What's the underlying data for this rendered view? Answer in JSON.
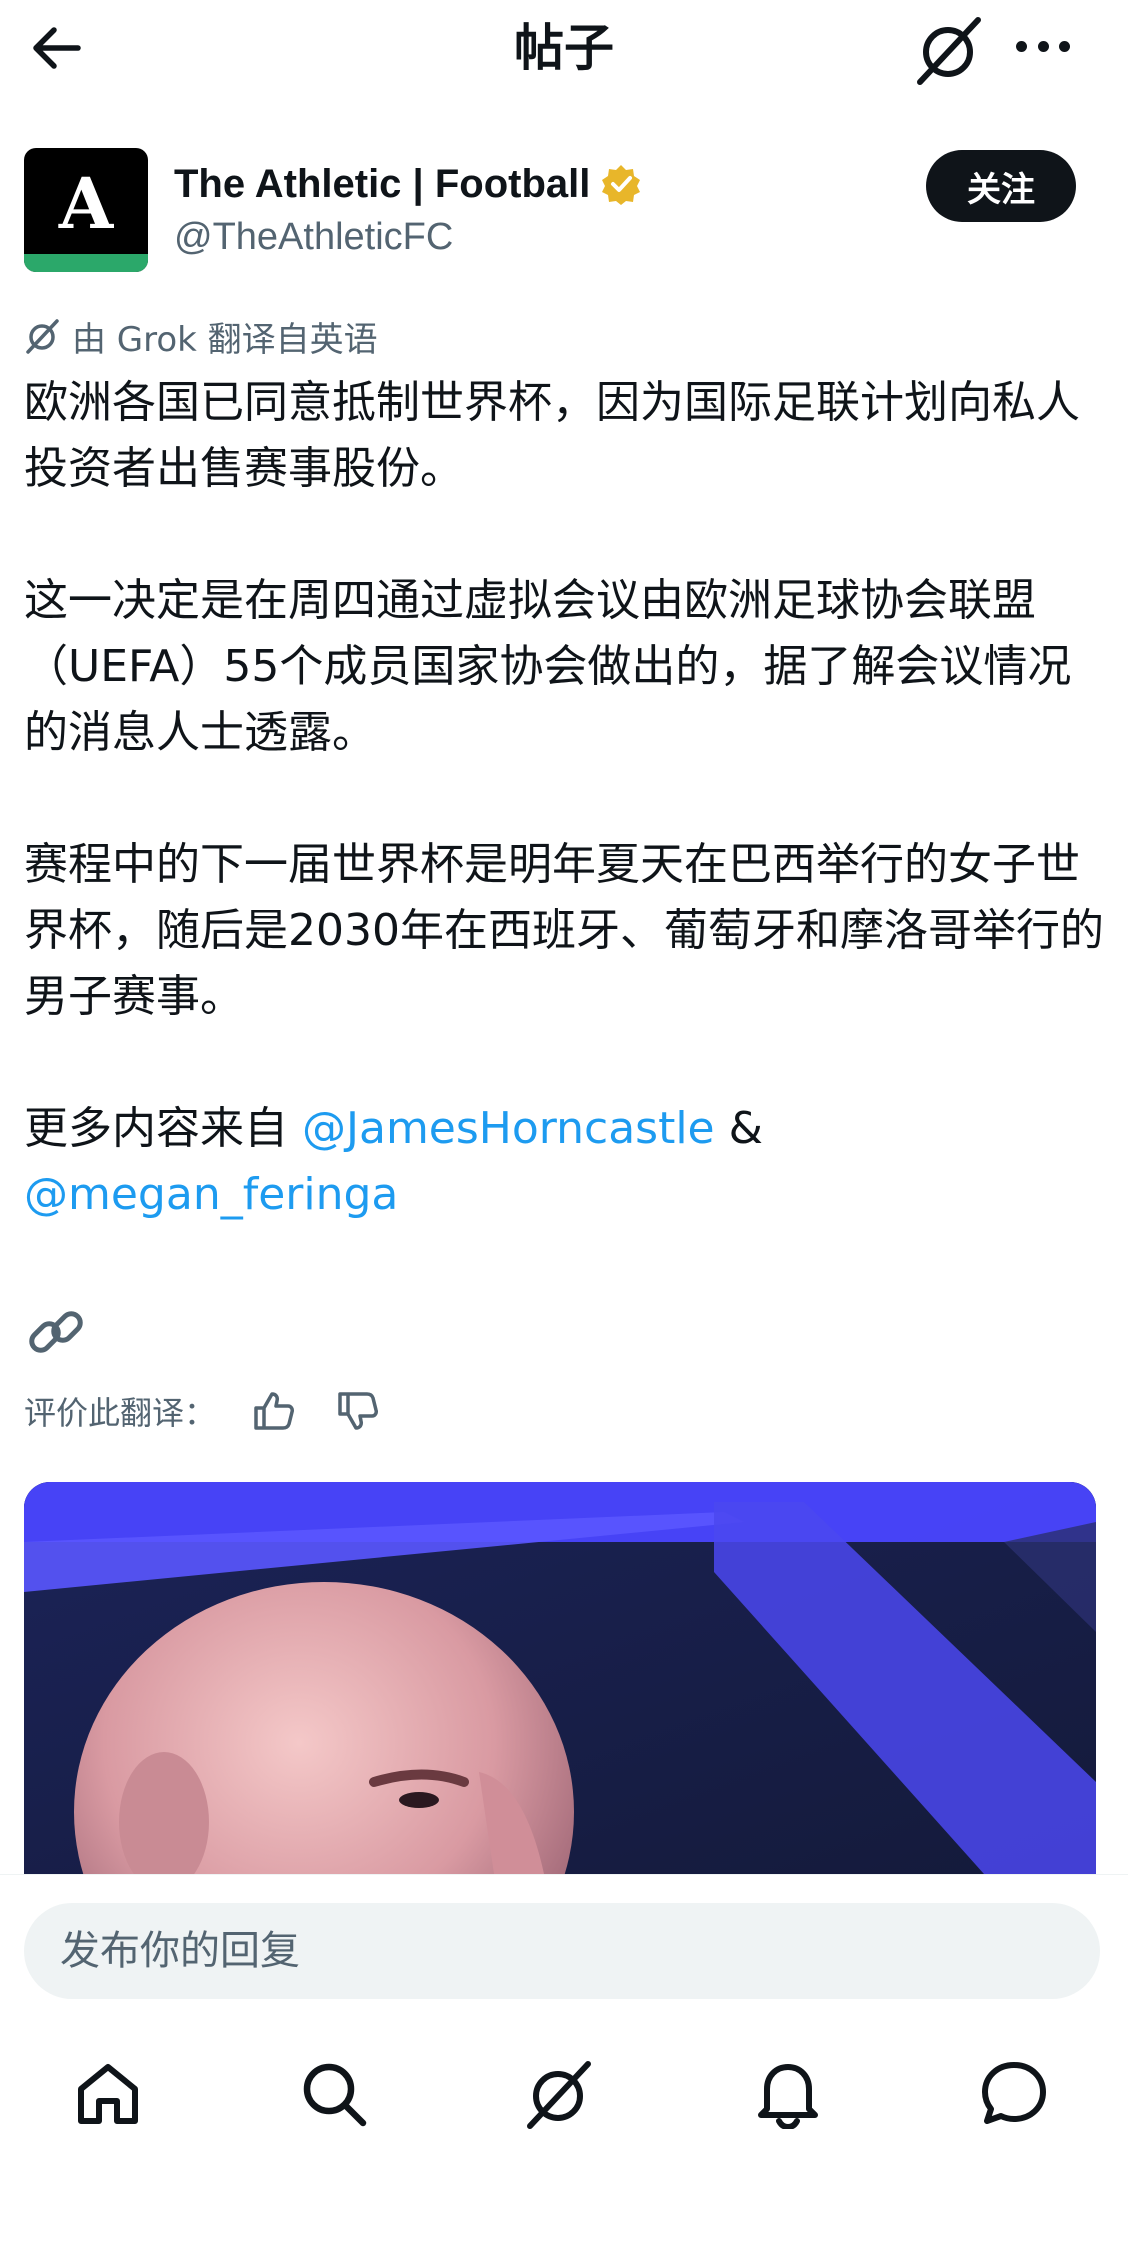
{
  "header": {
    "title": "帖子"
  },
  "author": {
    "name": "The Athletic | Football",
    "handle": "@TheAthleticFC",
    "avatar_letter": "A",
    "follow_label": "关注"
  },
  "translation": {
    "label": "由 Grok 翻译自英语"
  },
  "post": {
    "paragraph1": "欧洲各国已同意抵制世界杯，因为国际足联计划向私人投资者出售赛事股份。",
    "paragraph2": "这一决定是在周四通过虚拟会议由欧洲足球协会联盟（UEFA）55个成员国家协会做出的，据了解会议情况的消息人士透露。",
    "paragraph3": "赛程中的下一届世界杯是明年夏天在巴西举行的女子世界杯，随后是2030年在西班牙、葡萄牙和摩洛哥举行的男子赛事。",
    "more_prefix": "更多内容来自 ",
    "mention1": "@JamesHorncastle",
    "amp": " &",
    "mention2": "@megan_feringa"
  },
  "rating": {
    "label": "评价此翻译："
  },
  "reply": {
    "placeholder": "发布你的回复"
  },
  "nav": [
    "home-icon",
    "search-icon",
    "grok-icon",
    "notifications-icon",
    "messages-icon"
  ],
  "colors": {
    "accent": "#1d9bf0",
    "text": "#0f1419",
    "muted": "#536471",
    "verified": "#e8b62a"
  }
}
